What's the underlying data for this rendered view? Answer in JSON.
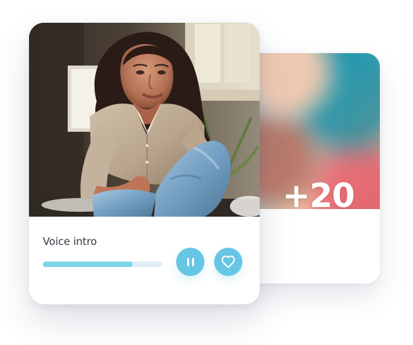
{
  "profile_stack": {
    "extra_count": "+20",
    "voice_intro": {
      "label": "Voice intro",
      "progress": 0.75,
      "playing": true
    },
    "actions": [
      {
        "name": "pause",
        "icon": "pause-icon"
      },
      {
        "name": "like",
        "icon": "heart-icon"
      }
    ]
  },
  "colors": {
    "accent": "#66c6e4",
    "progress_fill": "#7fd3e6",
    "progress_track": "#dfeff6",
    "card_background": "#ffffff",
    "text": "#333844"
  }
}
